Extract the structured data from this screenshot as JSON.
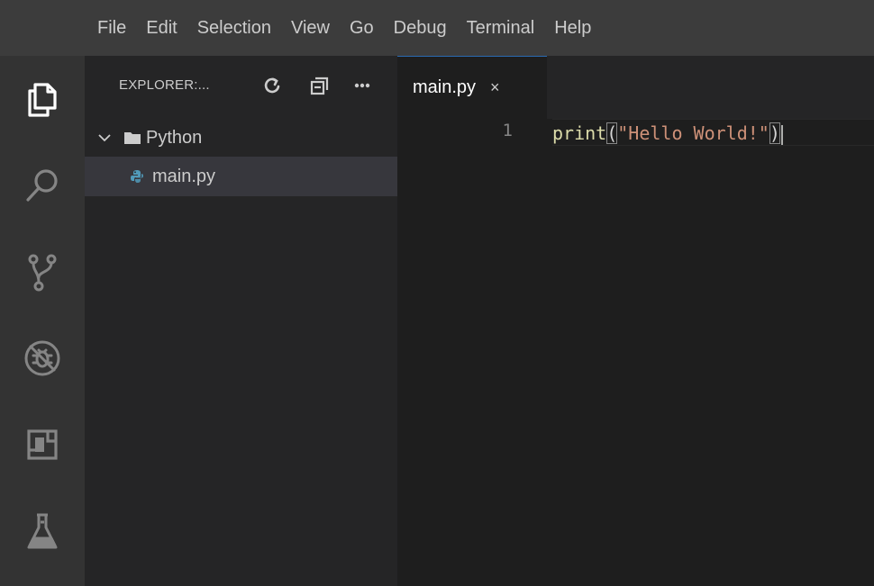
{
  "menu": [
    "File",
    "Edit",
    "Selection",
    "View",
    "Go",
    "Debug",
    "Terminal",
    "Help"
  ],
  "activity_bar": {
    "icons": [
      "explorer-icon",
      "search-icon",
      "source-control-icon",
      "debug-icon",
      "extensions-icon",
      "test-flask-icon"
    ]
  },
  "sidebar": {
    "title": "EXPLORER:...",
    "actions": [
      "refresh-icon",
      "collapse-all-icon",
      "more-icon"
    ],
    "folder": "Python",
    "file": "main.py"
  },
  "editor": {
    "tab_label": "main.py",
    "tab_close": "×",
    "line_number": "1",
    "code": {
      "fn": "print",
      "open_paren": "(",
      "string": "\"Hello World!\"",
      "close_paren": ")"
    }
  },
  "colors": {
    "menubar": "#3c3c3c",
    "activitybar": "#333333",
    "sidebar": "#252526",
    "editor": "#1e1e1e",
    "selected_row": "#37373d",
    "function": "#dcdcaa",
    "string": "#ce9178"
  }
}
